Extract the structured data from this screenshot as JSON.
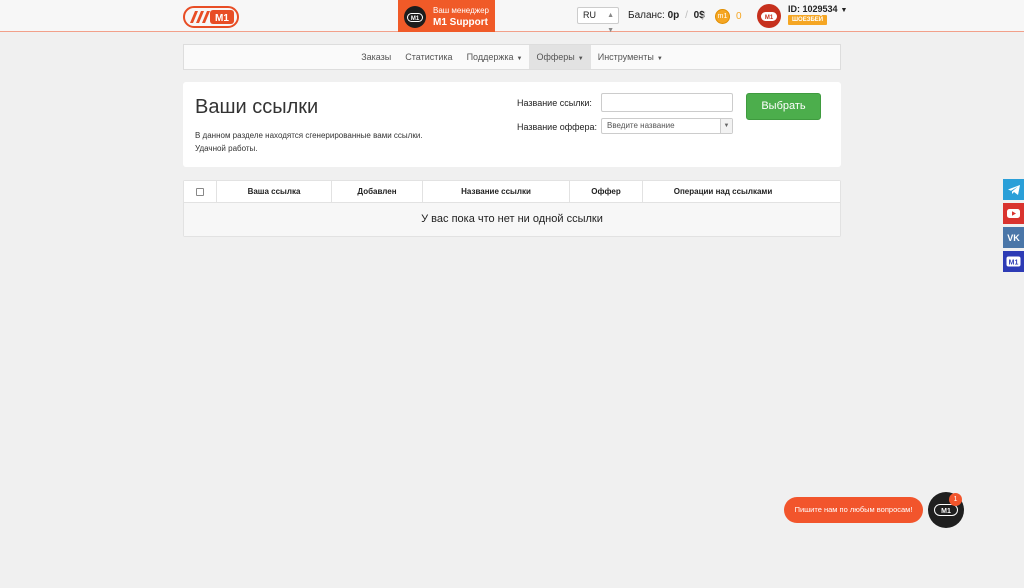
{
  "header": {
    "logo_text": "M1",
    "manager": {
      "label": "Ваш менеджер",
      "name": "M1 Support",
      "avatar_text": "M1"
    },
    "language": "RU",
    "balance": {
      "label": "Баланс:",
      "rub": "0р",
      "sep": "/",
      "usd": "0$"
    },
    "coins": {
      "icon_text": "m1",
      "count": "0"
    },
    "user": {
      "avatar_text": "M1",
      "id": "ID: 1029534",
      "badge": "ШОЕЗБЕЙ"
    }
  },
  "nav": {
    "items": [
      {
        "label": "Заказы",
        "dropdown": false
      },
      {
        "label": "Статистика",
        "dropdown": false
      },
      {
        "label": "Поддержка",
        "dropdown": true
      },
      {
        "label": "Офферы",
        "dropdown": true,
        "active": true
      },
      {
        "label": "Инструменты",
        "dropdown": true
      }
    ]
  },
  "panel": {
    "title": "Ваши ссылки",
    "description_line1": "В данном разделе находятся сгенерированные вами ссылки.",
    "description_line2": "Удачной работы.",
    "link_name_label": "Название ссылки:",
    "link_name_value": "",
    "offer_name_label": "Название оффера:",
    "offer_placeholder": "Введите название",
    "submit_label": "Выбрать"
  },
  "table": {
    "columns": [
      "Ваша ссылка",
      "Добавлен",
      "Название ссылки",
      "Оффер",
      "Операции над ссылками"
    ],
    "empty_message": "У вас пока что нет ни одной ссылки"
  },
  "social": [
    "telegram",
    "youtube",
    "vk",
    "m1"
  ],
  "chat": {
    "bubble_text": "Пишите нам по любым вопросам!",
    "avatar_text": "M1",
    "unread_count": "1"
  },
  "colors": {
    "brand": "#f05a28",
    "accent_green": "#4cae4c",
    "coin": "#f5a623"
  }
}
